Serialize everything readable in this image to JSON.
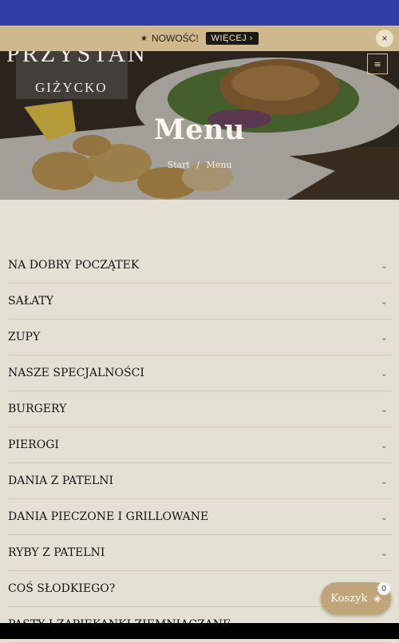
{
  "promo": {
    "new_label": "NOWOŚĆ!",
    "more_label": "WIĘCEJ",
    "close_label": "×"
  },
  "logo": {
    "name": "PRZYSTAN",
    "city": "GIŻYCKO"
  },
  "hero": {
    "title": "Menu",
    "breadcrumb": [
      "Start",
      "Menu"
    ]
  },
  "menu": {
    "categories": [
      "NA DOBRY POCZĄTEK",
      "SAŁATY",
      "ZUPY",
      "NASZE SPECJALNOŚCI",
      "BURGERY",
      "PIEROGI",
      "DANIA Z PATELNI",
      "DANIA PIECZONE I GRILLOWANE",
      "RYBY Z PATELNI",
      "COŚ SŁODKIEGO?",
      "PASTY I ZAPIEKANKI ZIEMNIACZANE"
    ]
  },
  "cart": {
    "label": "Koszyk",
    "count": "0"
  },
  "colors": {
    "topbar": "#2f3ea4",
    "promo": "#cfb88e",
    "accent": "#c1a57a",
    "background": "#e4e0d3"
  }
}
